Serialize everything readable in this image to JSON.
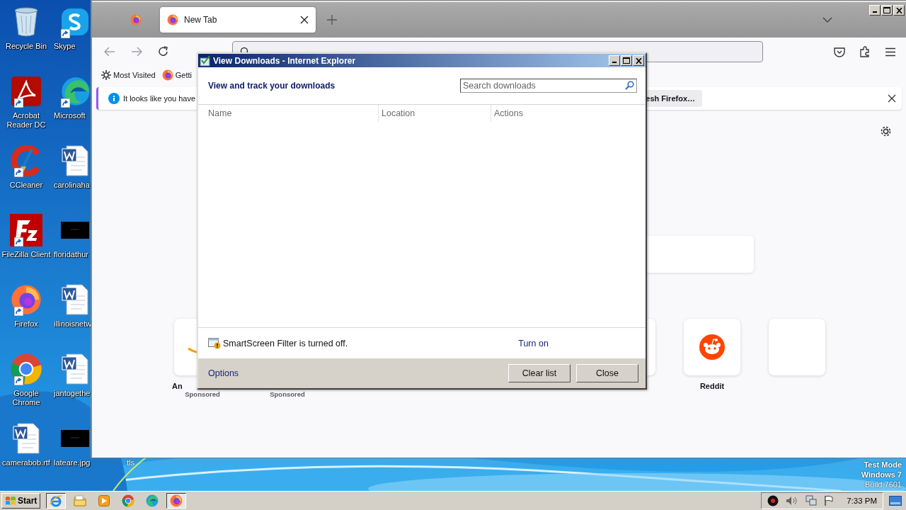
{
  "desktop": {
    "icons": [
      {
        "label": "Recycle Bin",
        "kind": "recycle-bin",
        "shortcut": false
      },
      {
        "label": "Skype",
        "kind": "skype",
        "shortcut": true
      },
      {
        "label": "Acrobat Reader DC",
        "kind": "acrobat",
        "shortcut": true
      },
      {
        "label": "Microsoft",
        "kind": "edge",
        "shortcut": true
      },
      {
        "label": "CCleaner",
        "kind": "ccleaner",
        "shortcut": true
      },
      {
        "label": "carolinaha",
        "kind": "word",
        "shortcut": false
      },
      {
        "label": "FileZilla Client",
        "kind": "filezilla",
        "shortcut": true
      },
      {
        "label": "floridathur",
        "kind": "dark-image",
        "shortcut": false
      },
      {
        "label": "Firefox",
        "kind": "firefox",
        "shortcut": true
      },
      {
        "label": "illinoisnetw",
        "kind": "word",
        "shortcut": false
      },
      {
        "label": "Google Chrome",
        "kind": "chrome",
        "shortcut": true
      },
      {
        "label": "jantogethe",
        "kind": "word",
        "shortcut": false
      },
      {
        "label": "camerabob.rtf",
        "kind": "word",
        "shortcut": false
      },
      {
        "label": "lateare.jpg",
        "kind": "dark-image",
        "shortcut": false
      }
    ],
    "covered_icon_label": "tls",
    "system_notice": [
      "Test Mode",
      "Windows 7",
      "Build 7601"
    ]
  },
  "browser": {
    "tabs": [
      {
        "kind": "pinned",
        "selected": false
      },
      {
        "kind": "tab",
        "label": "New Tab",
        "selected": true
      }
    ],
    "bookmarks": [
      {
        "kind": "gear",
        "label": "Most Visited"
      },
      {
        "kind": "firefox",
        "label": "Getti"
      }
    ],
    "notification": {
      "text": "It looks like you have",
      "button": "esh Firefox…"
    },
    "shortcuts": [
      {
        "kind": "amazon",
        "title": "An",
        "sponsored": "Sponsored"
      },
      {
        "kind": "hidden",
        "sponsored": "Sponsored"
      },
      {
        "kind": "blank"
      },
      {
        "kind": "reddit",
        "title": "Reddit"
      },
      {
        "kind": "blank"
      }
    ]
  },
  "downloads_dialog": {
    "title": "View Downloads - Internet Explorer",
    "heading": "View and track your downloads",
    "search": {
      "placeholder": "Search downloads"
    },
    "columns": [
      "Name",
      "Location",
      "Actions"
    ],
    "smartscreen": {
      "text": "SmartScreen Filter is turned off.",
      "link": "Turn on"
    },
    "options_link": "Options",
    "buttons": [
      "Clear list",
      "Close"
    ]
  },
  "taskbar": {
    "start": "Start",
    "items": [
      {
        "kind": "ie",
        "selected": true
      },
      {
        "kind": "folder",
        "selected": false
      },
      {
        "kind": "media",
        "selected": false
      },
      {
        "kind": "chrome",
        "selected": false
      },
      {
        "kind": "edge",
        "selected": false
      },
      {
        "kind": "firefox",
        "selected": true
      }
    ],
    "clock": "7:33 PM"
  }
}
